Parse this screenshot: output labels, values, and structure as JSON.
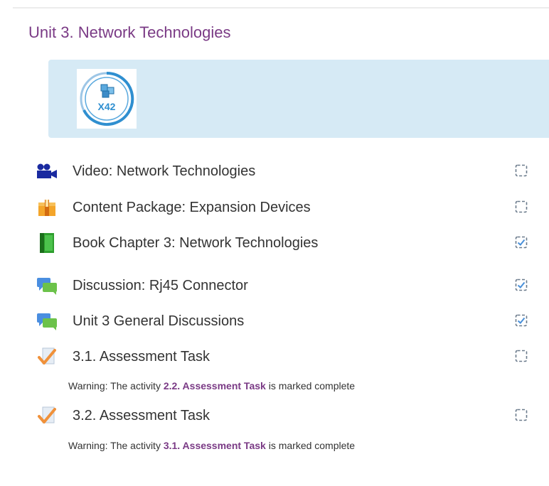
{
  "section": {
    "title": "Unit 3. Network Technologies"
  },
  "banner": {
    "logo_text": "X42",
    "logo_icon": "network-cube-icon"
  },
  "activities": [
    {
      "name": "Video: Network Technologies",
      "icon": "video-camera-icon",
      "completed": false
    },
    {
      "name": "Content Package: Expansion Devices",
      "icon": "package-box-icon",
      "completed": false
    },
    {
      "name": "Book Chapter 3: Network Technologies",
      "icon": "book-icon",
      "completed": true
    },
    {
      "name": "Discussion: Rj45 Connector",
      "icon": "forum-bubbles-icon",
      "completed": true
    },
    {
      "name": "Unit 3 General Discussions",
      "icon": "forum-bubbles-icon",
      "completed": true
    },
    {
      "name": "3.1. Assessment Task",
      "icon": "assignment-check-icon",
      "completed": false
    },
    {
      "name": "3.2. Assessment Task",
      "icon": "assignment-check-icon",
      "completed": false
    }
  ],
  "warnings": [
    {
      "prefix": "Warning: The activity ",
      "link": "2.2. Assessment Task",
      "suffix": " is marked complete"
    },
    {
      "prefix": "Warning: The activity ",
      "link": "3.1. Assessment Task",
      "suffix": " is marked complete"
    }
  ],
  "colors": {
    "title": "#7a3a85",
    "banner": "#d6eaf5",
    "link": "#7a3a85",
    "checkbox": "#6b7b8c",
    "check": "#4a90d9"
  }
}
